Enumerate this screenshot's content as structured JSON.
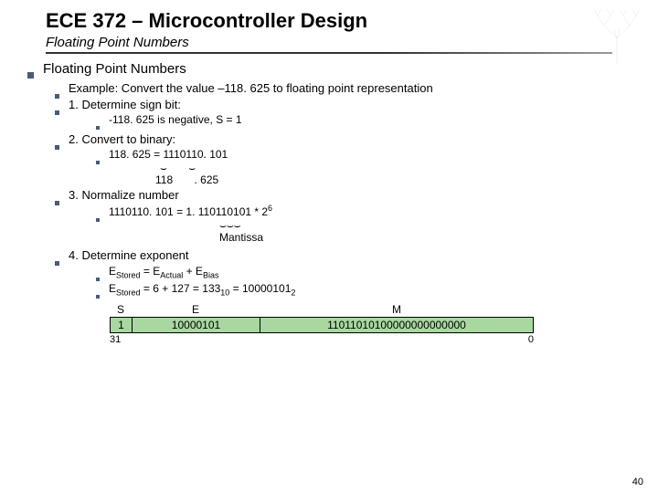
{
  "header": {
    "title": "ECE 372 – Microcontroller Design",
    "subtitle": "Floating Point Numbers"
  },
  "section": {
    "heading": "Floating Point Numbers",
    "example": "Example: Convert the value –118. 625 to floating point representation",
    "step1": {
      "label": "1. Determine sign bit:",
      "detail": "-118. 625 is negative, S = 1"
    },
    "step2": {
      "label": "2. Convert to binary:",
      "detail": "118. 625 = 1110110. 101",
      "left": "118",
      "right": ". 625"
    },
    "step3": {
      "label": "3. Normalize number",
      "detail": "1110110. 101 = 1. 110110101 * 2",
      "exp": "6",
      "mantissa": "Mantissa"
    },
    "step4": {
      "label": "4. Determine exponent",
      "eq1a": "E",
      "eq1b": "Stored",
      "eq1c": " = E",
      "eq1d": "Actual",
      "eq1e": " + E",
      "eq1f": "Bias",
      "eq2a": "E",
      "eq2b": "Stored",
      "eq2c": " = 6 + 127 = 133",
      "eq2d": "10",
      "eq2e": " = 10000101",
      "eq2f": "2"
    }
  },
  "bits": {
    "S": "S",
    "E": "E",
    "M": "M",
    "s_val": "1",
    "e_val": "10000101",
    "m_val": "11011010100000000000000",
    "left": "31",
    "right": "0"
  },
  "page": "40"
}
